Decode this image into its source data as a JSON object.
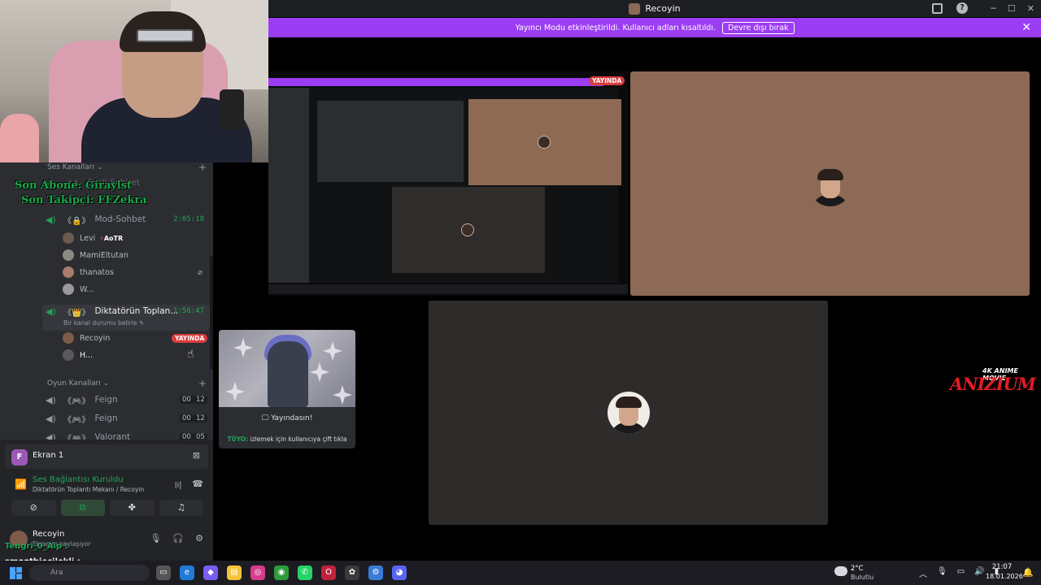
{
  "window": {
    "title": "Recoyin"
  },
  "banner": {
    "text": "Yayıncı Modu etkinleştirildi. Kullanıcı adları kısaltıldı.",
    "button": "Devre dışı bırak"
  },
  "overlay": {
    "last_sub": "Son Abone: Giraylst",
    "last_follow": "Son Takipçi: FFZekra"
  },
  "sidebar": {
    "voice_category": "Ses Kanalları",
    "top_faded": "Sesli Sohbet",
    "mod_channel": {
      "name": "Mod-Sohbet",
      "time": "2:05:18"
    },
    "mod_users": [
      {
        "name": "Levi",
        "tag": "AoTR"
      },
      {
        "name": "MamiEltutan"
      },
      {
        "name": "thanatos"
      },
      {
        "name": "W..."
      }
    ],
    "active_channel": {
      "name": "Diktatörün Toplan...",
      "time": "1:56:47",
      "status": "Bir kanal durumu belirle"
    },
    "active_users": [
      {
        "name": "Recoyin",
        "badge": "YAYINDA"
      },
      {
        "name": "H..."
      }
    ],
    "game_category": "Oyun Kanalları",
    "game_channels": [
      {
        "name": "Feign",
        "n1": "00",
        "n2": "12"
      },
      {
        "name": "Feign",
        "n1": "00",
        "n2": "12"
      },
      {
        "name": "Valorant",
        "n1": "00",
        "n2": "05"
      }
    ]
  },
  "panel": {
    "screen_badge": "F",
    "screen_name": "Ekran 1",
    "connection": "Ses Bağlantısı Kuruldu",
    "connection_sub": "Diktatörün Toplantı Mekanı / Recoyin",
    "user_name": "Recoyin",
    "user_status": "Ekranını paylaşıyor"
  },
  "chat": {
    "line1": "Tengri_0_Alp :",
    "line2": "smoothiecilekli :"
  },
  "stage": {
    "live_badge": "YAYINDA",
    "live_tile_caption": "Yayındasın!",
    "tip_label": "TÜYO:",
    "tip_text": "izlemek için kullanıcıya çift tıkla"
  },
  "logo": {
    "top": "4K ANIME MOVIE",
    "main": "ANIZIUM"
  },
  "taskbar": {
    "search": "Ara",
    "temp": "2°C",
    "weather": "Bulutlu",
    "time": "21:07",
    "date": "18.01.2026"
  }
}
